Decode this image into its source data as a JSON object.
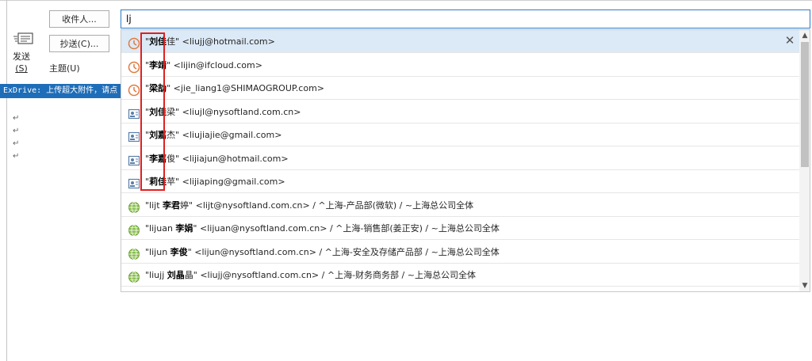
{
  "compose": {
    "send_label": "发送",
    "send_shortcut": "(S)",
    "to_button": "收件人...",
    "cc_button": "抄送(C)...",
    "subject_label": "主题(U)",
    "to_value": "lj",
    "banner": "ExDrive: 上传超大附件，请点",
    "paragraph_mark": "↵"
  },
  "suggestions": [
    {
      "type": "recent",
      "name_bold": "刘佳",
      "name_rest": "佳",
      "email": "<liujj@hotmail.com>",
      "path": ""
    },
    {
      "type": "recent",
      "name_bold": "李靖",
      "name_rest": "",
      "email": "<lijin@ifcloud.com>",
      "path": ""
    },
    {
      "type": "recent",
      "name_bold": "梁劼",
      "name_rest": "",
      "email": "<jie_liang1@SHIMAOGROUP.com>",
      "path": ""
    },
    {
      "type": "contact",
      "name_bold": "刘佳",
      "name_rest": "梁",
      "email": "<liujl@nysoftland.com.cn>",
      "path": ""
    },
    {
      "type": "contact",
      "name_bold": "刘嘉",
      "name_rest": "杰",
      "email": "<liujiajie@gmail.com>",
      "path": ""
    },
    {
      "type": "contact",
      "name_bold": "李嘉",
      "name_rest": "俊",
      "email": "<lijiajun@hotmail.com>",
      "path": ""
    },
    {
      "type": "contact",
      "name_bold": "莉佳",
      "name_rest": "苹",
      "email": "<lijiaping@gmail.com>",
      "path": ""
    },
    {
      "type": "directory",
      "prefix": "lijt ",
      "name_bold": "李君",
      "name_rest": "婷",
      "email": "<lijt@nysoftland.com.cn>",
      "path": "/ ^上海-产品部(微软) / ~上海总公司全体"
    },
    {
      "type": "directory",
      "prefix": "lijuan ",
      "name_bold": "李娟",
      "name_rest": "",
      "email": "<lijuan@nysoftland.com.cn>",
      "path": "/ ^上海-销售部(姜正安) / ~上海总公司全体"
    },
    {
      "type": "directory",
      "prefix": "lijun ",
      "name_bold": "李俊",
      "name_rest": "",
      "email": "<lijun@nysoftland.com.cn>",
      "path": "/ ^上海-安全及存储产品部 / ~上海总公司全体"
    },
    {
      "type": "directory",
      "prefix": "liujj ",
      "name_bold": "刘晶",
      "name_rest": "晶",
      "email": "<liujj@nysoftland.com.cn>",
      "path": "/ ^上海-财务商务部 / ~上海总公司全体"
    }
  ],
  "colors": {
    "accent": "#2b7bc7",
    "highlight": "#e02020",
    "selected": "#dce9f6"
  },
  "icons": {
    "recent": "clock-icon",
    "contact": "contact-card-icon",
    "directory": "globe-icon",
    "dismiss": "close-icon"
  }
}
